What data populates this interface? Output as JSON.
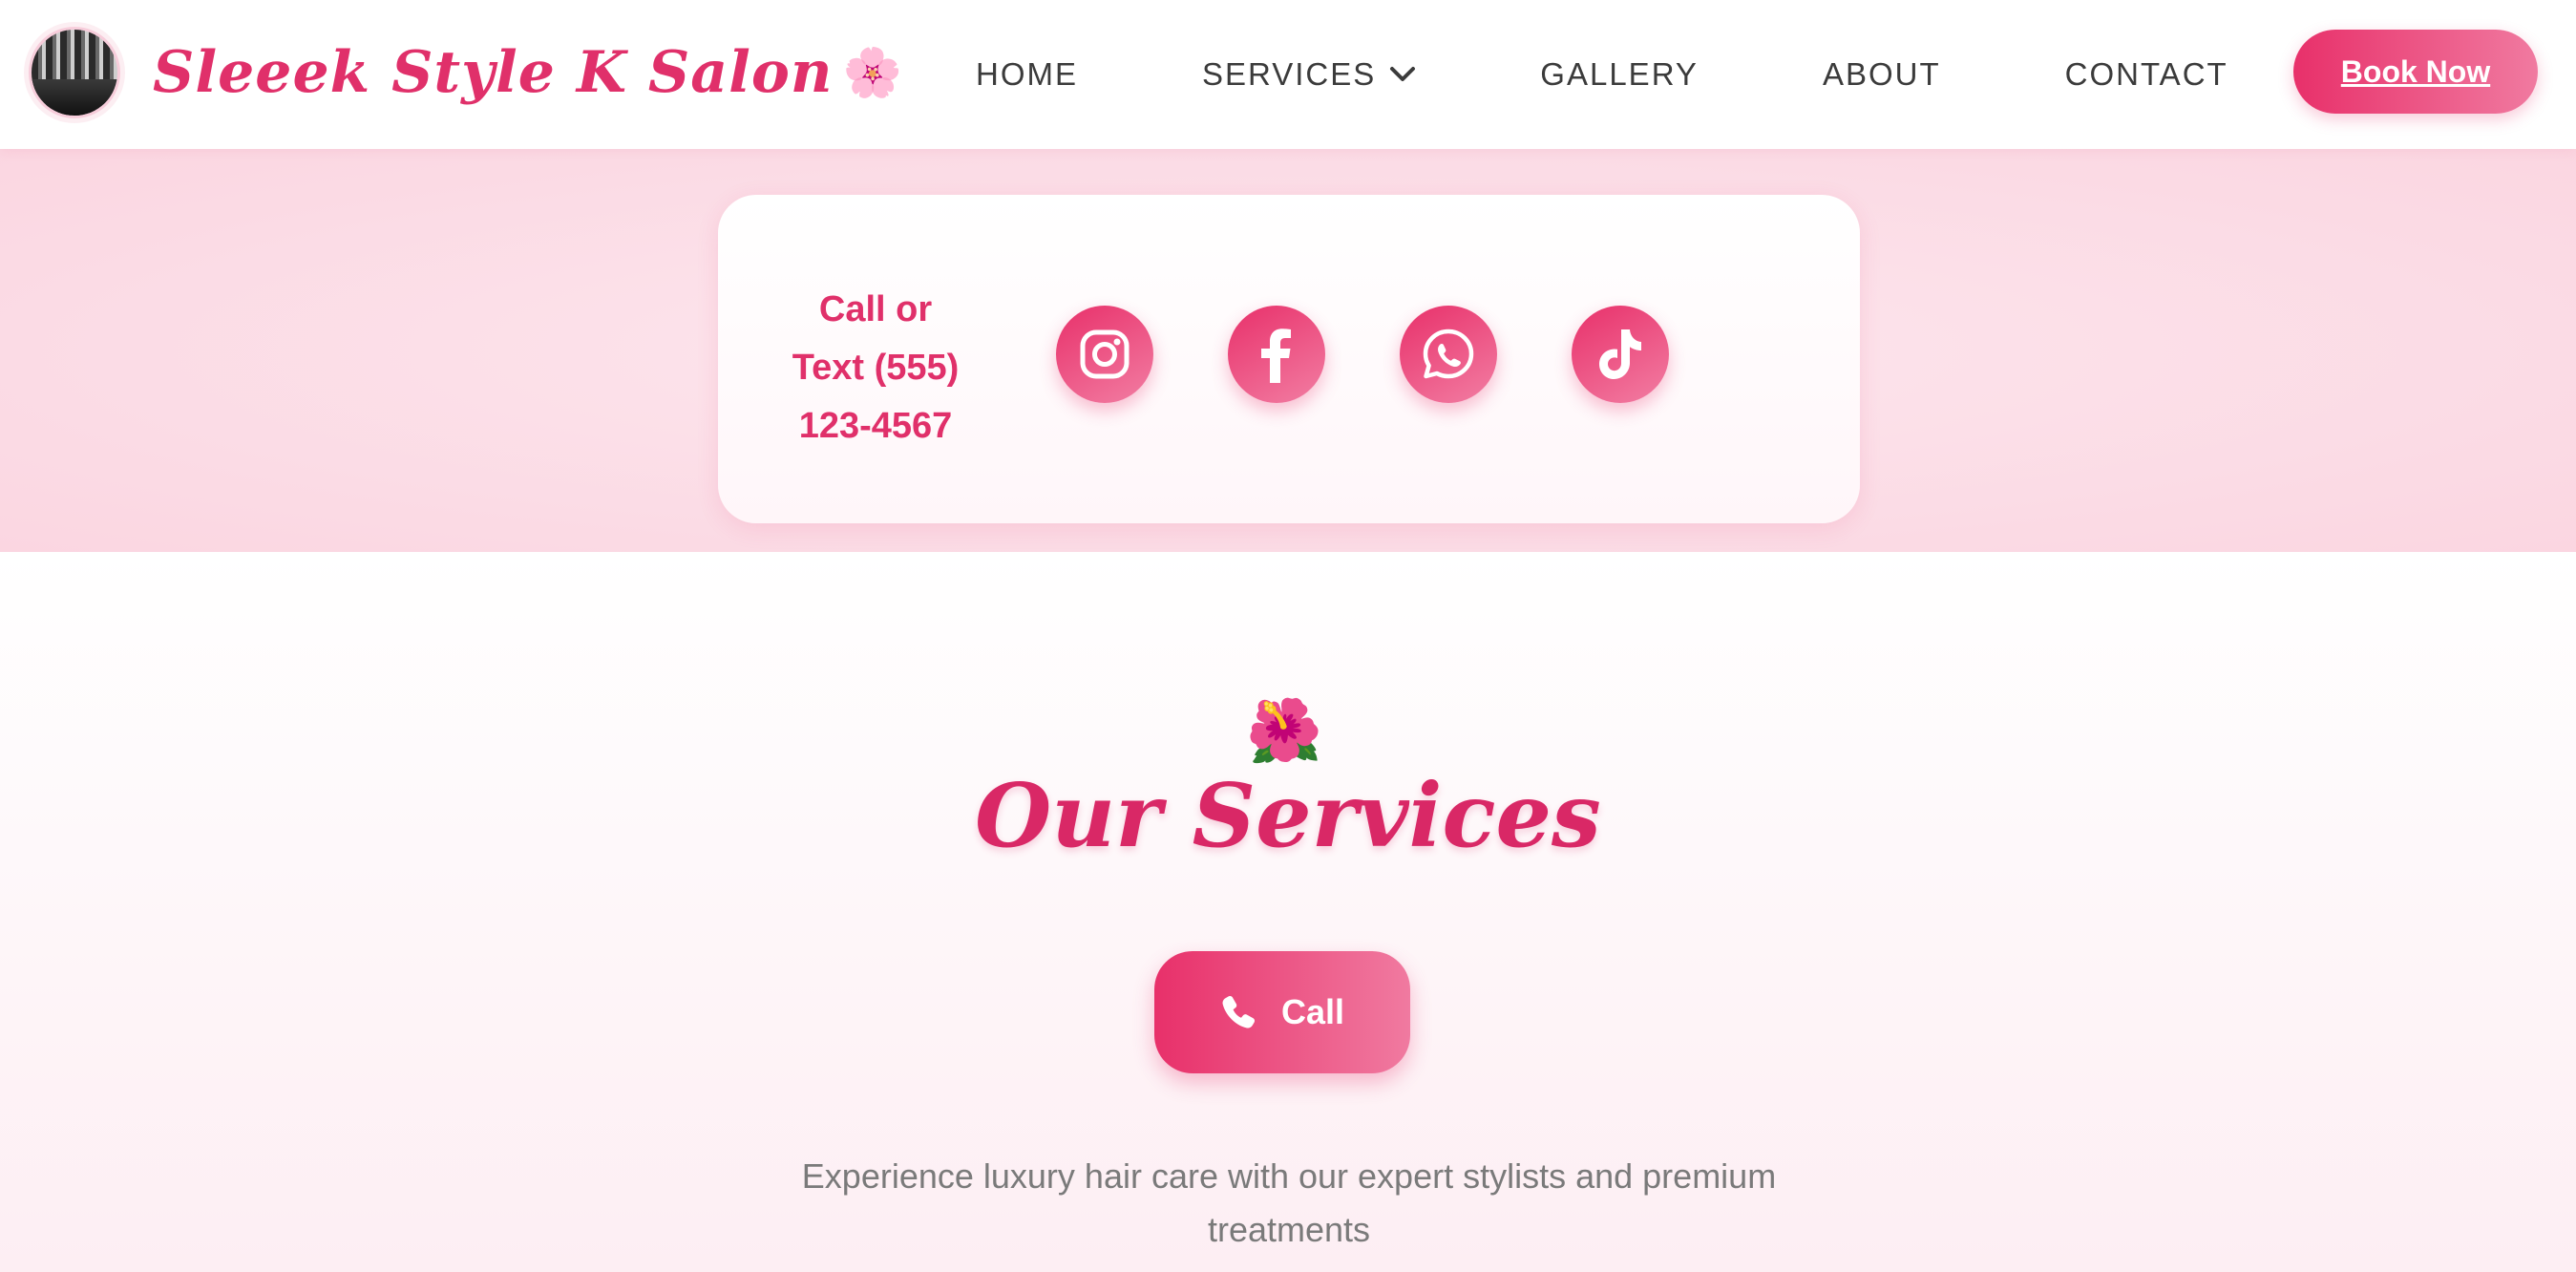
{
  "brand": {
    "name": "Sleeek Style K Salon",
    "flower": "🌸",
    "logo": "salon-interior-photo"
  },
  "nav": {
    "items": [
      {
        "label": "HOME"
      },
      {
        "label": "SERVICES",
        "has_dropdown": true
      },
      {
        "label": "GALLERY"
      },
      {
        "label": "ABOUT"
      },
      {
        "label": "CONTACT"
      }
    ],
    "cta": "Book Now"
  },
  "contact": {
    "text_lines": [
      "Call or",
      "Text (555)",
      "123-4567"
    ],
    "socials": [
      {
        "icon": "instagram-icon"
      },
      {
        "icon": "facebook-icon"
      },
      {
        "icon": "whatsapp-icon"
      },
      {
        "icon": "tiktok-icon"
      }
    ]
  },
  "services": {
    "emoji": "🌺",
    "title": "Our Services",
    "call_label": "Call",
    "description": "Experience luxury hair care with our expert stylists and premium treatments"
  },
  "colors": {
    "accent": "#e8306a",
    "accent_light": "#f07aa0",
    "title": "#d92866",
    "band_bg": "#fbdbe5"
  }
}
